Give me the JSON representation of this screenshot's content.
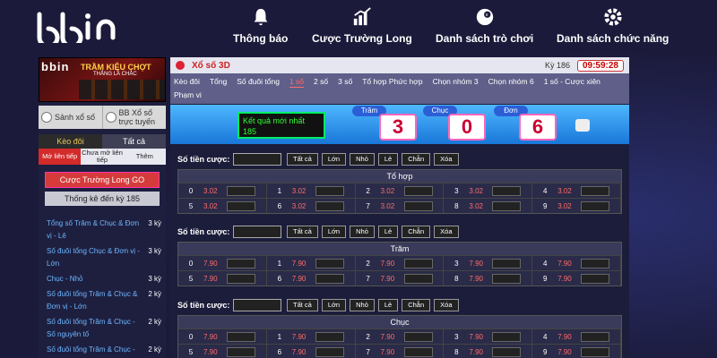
{
  "brand": {
    "logo": "bbin"
  },
  "topnav": [
    {
      "label": "Thông báo",
      "icon": "bell-icon"
    },
    {
      "label": "Cược Trường Long",
      "icon": "bar-chart-icon"
    },
    {
      "label": "Danh sách trò chơi",
      "icon": "ball-icon"
    },
    {
      "label": "Danh sách chức năng",
      "icon": "gear-icon"
    }
  ],
  "sidebar": {
    "banner": {
      "logo": "bbin",
      "title": "TRẦM KIỆU CHỢT",
      "subtitle": "THẮNG LÀ CHẮC"
    },
    "quick": [
      {
        "label": "Sảnh xổ số"
      },
      {
        "label": "BB Xổ số trực tuyến"
      }
    ],
    "tabs1": [
      "Kèo đôi",
      "Tất cả"
    ],
    "tabs2": [
      "Mở liên tiếp",
      "Chưa mở liên tiếp",
      "Thêm"
    ],
    "btn_long": "Cược Trường Long GO",
    "btn_stats": "Thống kê đến kỳ 185",
    "items": [
      {
        "text": "Tổng số Trăm & Chục & Đơn vị - Lê",
        "count": "3 kỳ"
      },
      {
        "text": "Số đuôi tổng Chục & Đơn vị - Lớn",
        "count": "3 kỳ"
      },
      {
        "text": "Chục - Nhỏ",
        "count": "3 kỳ"
      },
      {
        "text": "Số đuôi tổng Trăm & Chục & Đơn vị - Lớn",
        "count": "2 kỳ"
      },
      {
        "text": "Số đuôi tổng Trăm & Chục - Số nguyên tố",
        "count": "2 kỳ"
      },
      {
        "text": "Số đuôi tổng Trăm & Chục - Nhỏ",
        "count": "2 kỳ"
      }
    ]
  },
  "main": {
    "title": "Xổ số 3D",
    "period": "Kỳ 186",
    "timer": "09:59:28",
    "subnav": [
      "Kèo đôi",
      "Tổng",
      "Số đuôi tổng",
      "1 số",
      "2 số",
      "3 số",
      "Tổ hợp Phức hợp",
      "Chọn nhóm 3",
      "Chọn nhóm 6",
      "1 số - Cược xiên",
      "Phạm vi"
    ],
    "active_sub": "1 số",
    "result": {
      "label": "Kết quả mới nhất",
      "period": "185",
      "positions": [
        "Trăm",
        "Chục",
        "Đơn"
      ],
      "digits": [
        "3",
        "0",
        "6"
      ]
    },
    "bet_label": "Số tiền cược:",
    "chips": [
      "Tất cả",
      "Lớn",
      "Nhỏ",
      "Lẻ",
      "Chẵn",
      "Xóa"
    ],
    "sections": [
      {
        "title": "Tổ hợp",
        "rows": [
          [
            [
              "0",
              "3.02"
            ],
            [
              "1",
              "3.02"
            ],
            [
              "2",
              "3.02"
            ],
            [
              "3",
              "3.02"
            ],
            [
              "4",
              "3.02"
            ]
          ],
          [
            [
              "5",
              "3.02"
            ],
            [
              "6",
              "3.02"
            ],
            [
              "7",
              "3.02"
            ],
            [
              "8",
              "3.02"
            ],
            [
              "9",
              "3.02"
            ]
          ]
        ]
      },
      {
        "title": "Trăm",
        "rows": [
          [
            [
              "0",
              "7.90"
            ],
            [
              "1",
              "7.90"
            ],
            [
              "2",
              "7.90"
            ],
            [
              "3",
              "7.90"
            ],
            [
              "4",
              "7.90"
            ]
          ],
          [
            [
              "5",
              "7.90"
            ],
            [
              "6",
              "7.90"
            ],
            [
              "7",
              "7.90"
            ],
            [
              "8",
              "7.90"
            ],
            [
              "9",
              "7.90"
            ]
          ]
        ]
      },
      {
        "title": "Chục",
        "rows": [
          [
            [
              "0",
              "7.90"
            ],
            [
              "1",
              "7.90"
            ],
            [
              "2",
              "7.90"
            ],
            [
              "3",
              "7.90"
            ],
            [
              "4",
              "7.90"
            ]
          ],
          [
            [
              "5",
              "7.90"
            ],
            [
              "6",
              "7.90"
            ],
            [
              "7",
              "7.90"
            ],
            [
              "8",
              "7.90"
            ],
            [
              "9",
              "7.90"
            ]
          ]
        ]
      }
    ]
  }
}
